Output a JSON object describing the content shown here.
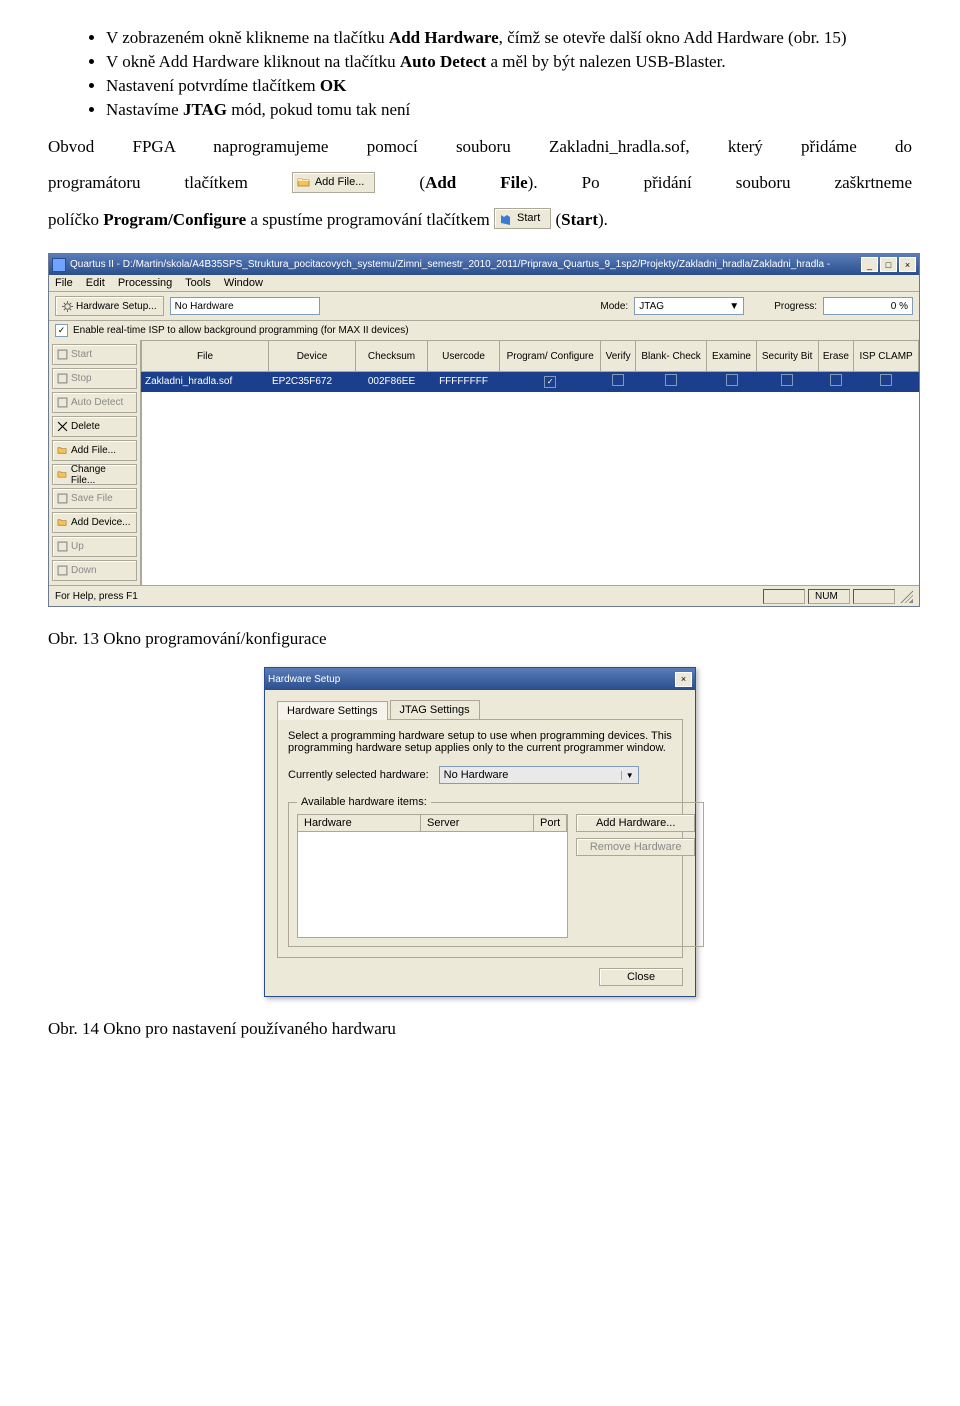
{
  "doc": {
    "bullets": [
      {
        "pre": "V zobrazeném okně klikneme na tlačítku ",
        "b1": "Add Hardware",
        "post": ", čímž se otevře další okno Add Hardware (obr. 15)"
      },
      {
        "pre": "V okně Add Hardware kliknout na tlačítku ",
        "b1": "Auto Detect",
        "post": " a měl by být nalezen USB-Blaster."
      },
      {
        "pre": "Nastavení potvrdíme tlačítkem ",
        "b1": "OK",
        "post": ""
      },
      {
        "pre": "Nastavíme ",
        "b1": "JTAG",
        "post": " mód, pokud tomu tak není"
      }
    ],
    "para1a": "Obvod FPGA naprogramujeme pomocí souboru Zakladni_hradla.sof, který přidáme do",
    "para1b_pre": "programátoru tlačítkem ",
    "para1b_post_pre": " (",
    "para1b_bold": "Add File",
    "para1b_post": "). Po přidání souboru zaškrtneme",
    "para2_pre": "políčko ",
    "para2_bold": "Program/Configure",
    "para2_mid": " a spustíme programování tlačítkem ",
    "para2_end_pre": " (",
    "para2_end_bold": "Start",
    "para2_end_post": ").",
    "addfile_label": "Add File...",
    "start_label": "Start",
    "fig13": "Obr. 13 Okno programování/konfigurace",
    "fig14": "Obr. 14 Okno pro nastavení používaného hardwaru"
  },
  "prog": {
    "title": "Quartus II - D:/Martin/skola/A4B35SPS_Struktura_pocitacovych_systemu/Zimni_semestr_2010_2011/Priprava_Quartus_9_1sp2/Projekty/Zakladni_hradla/Zakladni_hradla -",
    "menus": [
      "File",
      "Edit",
      "Processing",
      "Tools",
      "Window"
    ],
    "hw_setup_btn": "Hardware Setup...",
    "no_hw": "No Hardware",
    "mode_label": "Mode:",
    "mode_value": "JTAG",
    "progress_label": "Progress:",
    "progress_value": "0 %",
    "realtime_isp": "Enable real-time ISP to allow background programming (for MAX II devices)",
    "side_buttons": [
      {
        "label": "Start",
        "disabled": true
      },
      {
        "label": "Stop",
        "disabled": true
      },
      {
        "label": "Auto Detect",
        "disabled": true
      },
      {
        "label": "Delete",
        "disabled": false,
        "icon": "x"
      },
      {
        "label": "Add File...",
        "disabled": false,
        "icon": "folder"
      },
      {
        "label": "Change File...",
        "disabled": false,
        "icon": "folder"
      },
      {
        "label": "Save File",
        "disabled": true
      },
      {
        "label": "Add Device...",
        "disabled": false,
        "icon": "folder"
      },
      {
        "label": "Up",
        "disabled": true
      },
      {
        "label": "Down",
        "disabled": true
      }
    ],
    "cols": [
      "File",
      "Device",
      "Checksum",
      "Usercode",
      "Program/ Configure",
      "Verify",
      "Blank- Check",
      "Examine",
      "Security Bit",
      "Erase",
      "ISP CLAMP"
    ],
    "row": {
      "file": "Zakladni_hradla.sof",
      "device": "EP2C35F672",
      "checksum": "002F86EE",
      "usercode": "FFFFFFFF",
      "prog": true,
      "verify": false,
      "blank": false,
      "examine": false,
      "sec": false,
      "erase": false,
      "isp": false
    },
    "status_left": "For Help, press F1",
    "status_num": "NUM"
  },
  "dlg": {
    "title": "Hardware Setup",
    "tab1": "Hardware Settings",
    "tab2": "JTAG Settings",
    "desc": "Select a programming hardware setup to use when programming devices. This programming hardware setup applies only to the current programmer window.",
    "cur_label": "Currently selected hardware:",
    "cur_value": "No Hardware",
    "group_label": "Available hardware items:",
    "col_hw": "Hardware",
    "col_srv": "Server",
    "col_port": "Port",
    "add_btn": "Add Hardware...",
    "rm_btn": "Remove Hardware",
    "close_btn": "Close"
  }
}
